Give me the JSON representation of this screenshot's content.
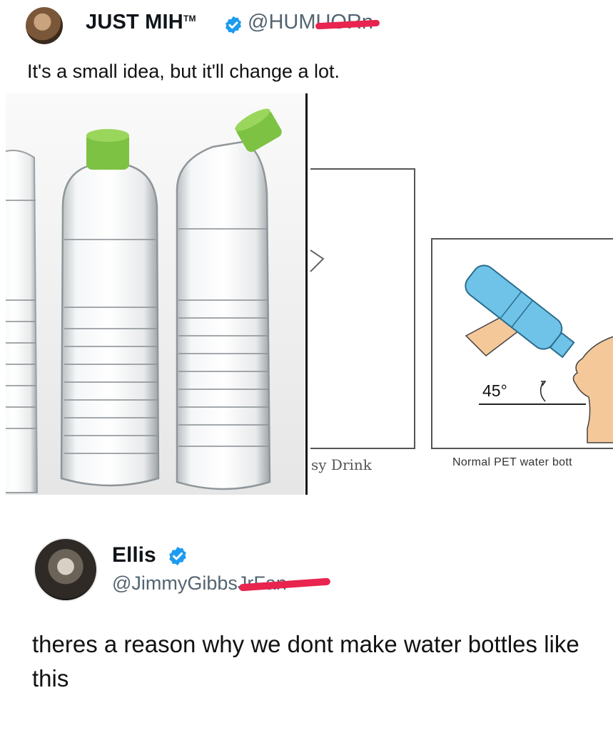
{
  "post": {
    "display_name": "JUST MIH",
    "trademark": "TM",
    "handle": "@HUMUORn",
    "text": "It's a small idea, but it'll change a lot."
  },
  "media": {
    "diagram": {
      "caption_left": "sy Drink",
      "caption_right": "Normal PET water bott",
      "angle_label": "45°"
    }
  },
  "reply": {
    "display_name": "Ellis",
    "handle": "@JimmyGibbsJrFan",
    "text": "theres a reason why we dont make water bottles like this"
  },
  "colors": {
    "verified": "#1d9bf0",
    "handle": "#536471",
    "redaction": "#e8244f",
    "cap_green": "#7dc242",
    "bottle_blue": "#6fc3e8",
    "skin": "#f5c89a"
  }
}
